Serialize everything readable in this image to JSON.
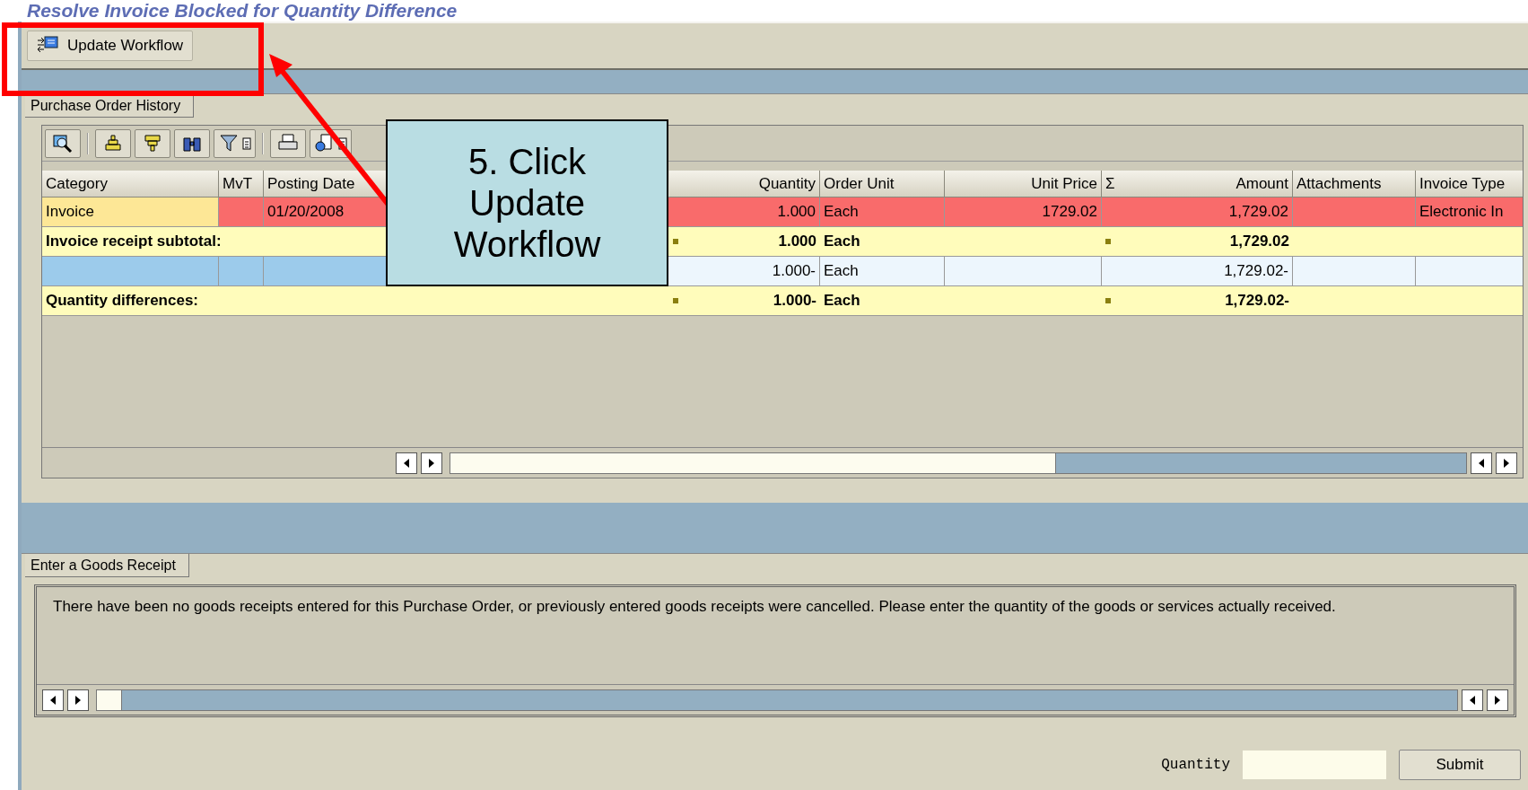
{
  "page_title": "Resolve Invoice Blocked for Quantity Difference",
  "toolbar": {
    "button": "Update Workflow"
  },
  "history_panel": {
    "tab": "Purchase Order History",
    "columns": [
      {
        "label": "Category"
      },
      {
        "label": "MvT"
      },
      {
        "label": "Posting Date"
      },
      {
        "label": "Quantity"
      },
      {
        "label": "Order Unit"
      },
      {
        "label": "Unit Price"
      },
      {
        "label": "Amount",
        "sum_mark": "Σ"
      },
      {
        "label": "Attachments"
      },
      {
        "label": "Invoice Type"
      }
    ],
    "rows": [
      {
        "kind": "item",
        "category": "Invoice",
        "posting_date": "01/20/2008",
        "quantity": "1.000",
        "order_unit": "Each",
        "unit_price": "1729.02",
        "amount": "1,729.02",
        "invoice_type": "Electronic In"
      },
      {
        "kind": "subtotal",
        "label": "Invoice receipt subtotal:",
        "quantity": "1.000",
        "order_unit": "Each",
        "amount": "1,729.02"
      },
      {
        "kind": "reversal",
        "quantity": "1.000-",
        "order_unit": "Each",
        "amount": "1,729.02-"
      },
      {
        "kind": "subtotal",
        "label": "Quantity differences:",
        "quantity": "1.000-",
        "order_unit": "Each",
        "amount": "1,729.02-"
      }
    ]
  },
  "goods_receipt_panel": {
    "tab": "Enter a Goods Receipt",
    "message": "There have been no goods receipts entered for this Purchase Order, or previously entered goods receipts were cancelled. Please enter the quantity of the goods or services actually received.",
    "quantity_label": "Quantity",
    "submit": "Submit"
  },
  "callout": {
    "text": "5. Click Update Workflow"
  }
}
